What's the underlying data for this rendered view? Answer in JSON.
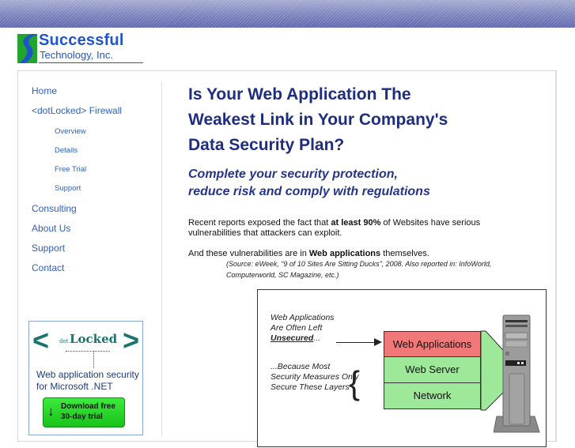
{
  "branding": {
    "company_line1": "Successful",
    "company_line2": "Technology, Inc.",
    "colors": {
      "brand_blue": "#1e56c8",
      "logo_green": "#22a52c",
      "banner_blue": "#7a82bd"
    }
  },
  "nav": {
    "items": [
      {
        "label": "Home",
        "level": 1
      },
      {
        "label": "<dotLocked> Firewall",
        "level": 1
      },
      {
        "label": "Overview",
        "level": 2
      },
      {
        "label": "Details",
        "level": 2
      },
      {
        "label": "Free Trial",
        "level": 2
      },
      {
        "label": "Support",
        "level": 2
      },
      {
        "label": "Consulting",
        "level": 1
      },
      {
        "label": "About Us",
        "level": 1
      },
      {
        "label": "Support",
        "level": 1
      },
      {
        "label": "Contact",
        "level": 1
      }
    ]
  },
  "ad": {
    "brand_prefix": "dot",
    "brand_name": "Locked",
    "lt": "<",
    "gt": ">",
    "tagline_line1": "Web application security",
    "tagline_line2": "for Microsoft .NET",
    "button_icon": "down-arrow-icon",
    "button_arrow": "↓",
    "button_line1": "Download free",
    "button_line2": "30-day trial"
  },
  "main": {
    "title_lines": [
      "Is Your Web Application The",
      "Weakest Link in Your Company's",
      "Data Security Plan?"
    ],
    "subtitle_lines": [
      "Complete your security protection,",
      "reduce risk and comply with regulations"
    ],
    "para1": {
      "before": "Recent reports exposed the fact that ",
      "bold": "at least 90%",
      "after": " of Websites have serious",
      "line2": "vulnerabilities that attackers can exploit."
    },
    "para2": {
      "before": "And these vulnerabilities are in ",
      "bold": "Web applications",
      "after": " themselves."
    },
    "source_line1": "(Source: eWeek, “9 of 10 Sites Are Sitting Ducks”, 2008. Also reported in: InfoWorld,",
    "source_line2": "Computerworld, SC Magazine, etc.)"
  },
  "diagram": {
    "left_text1_lines": [
      "Web Applications",
      "Are Often Left"
    ],
    "unsecured_bold": "Unsecured",
    "unsecured_suffix": "...",
    "left_text2_lines": [
      "...Because Most",
      "Security Measures Only",
      "Secure These Layers"
    ],
    "layers": [
      {
        "label": "Web Applications",
        "color": "#f07878"
      },
      {
        "label": "Web Server",
        "color": "#9ee89a"
      },
      {
        "label": "Network",
        "color": "#9ee89a"
      }
    ],
    "server_icon": "server-tower-icon"
  }
}
